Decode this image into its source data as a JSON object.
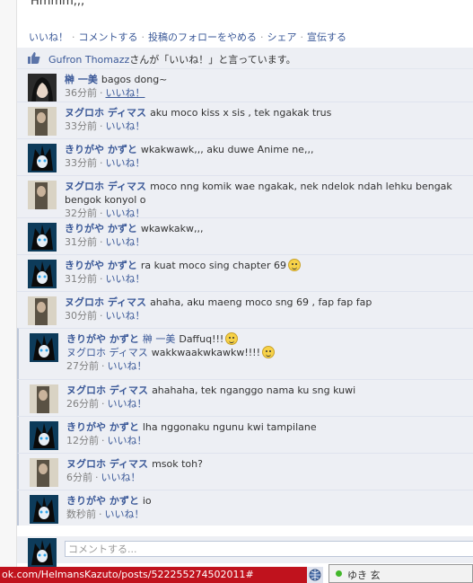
{
  "post": {
    "text": "Hmmm,,,"
  },
  "actions": [
    {
      "label": "いいね！"
    },
    {
      "label": "コメントする"
    },
    {
      "label": "投稿のフォローをやめる"
    },
    {
      "label": "シェア"
    },
    {
      "label": "宣伝する"
    }
  ],
  "likes": {
    "name": "Gufron Thomazz",
    "suffix": "さんが「いいね！」と言っています。"
  },
  "comments": [
    {
      "avatar": "black-hair",
      "author": "榊 一美",
      "text": "bagos dong~",
      "time": "36分前",
      "like": "いいね！"
    },
    {
      "avatar": "pale",
      "author": "ヌグロホ ディマス",
      "text": "aku moco kiss x sis , tek ngakak trus",
      "time": "33分前",
      "like": "いいね！"
    },
    {
      "avatar": "anime",
      "author": "きりがや かずと",
      "text": "wkakwawk,,, aku duwe Anime ne,,,",
      "time": "33分前",
      "like": "いいね！"
    },
    {
      "avatar": "pale",
      "author": "ヌグロホ ディマス",
      "text": "moco nng komik wae ngakak, nek ndelok ndah lehku bengak bengok konyol o",
      "time": "32分前",
      "like": "いいね！"
    },
    {
      "avatar": "anime",
      "author": "きりがや かずと",
      "text": "wkawkakw,,,",
      "time": "31分前",
      "like": "いいね！"
    },
    {
      "avatar": "anime",
      "author": "きりがや かずと",
      "text": "ra kuat moco sing chapter 69",
      "time": "31分前",
      "like": "いいね！"
    },
    {
      "avatar": "pale",
      "author": "ヌグロホ ディマス",
      "text": "ahaha, aku maeng moco sng 69 , fap fap fap",
      "time": "30分前",
      "like": "いいね！"
    },
    {
      "avatar": "anime",
      "author": "きりがや かずと",
      "mention": "榊 一美",
      "text": "Daffuq!!!",
      "mention2": "ヌグロホ ディマス",
      "text2": "wakkwaakwkawkw!!!!",
      "time": "27分前",
      "like": "いいね！"
    },
    {
      "avatar": "pale",
      "author": "ヌグロホ ディマス",
      "text": "ahahaha, tek nganggo nama ku sng kuwi",
      "time": "26分前",
      "like": "いいね！"
    },
    {
      "avatar": "anime",
      "author": "きりがや かずと",
      "text": "lha nggonaku ngunu kwi tampilane",
      "time": "12分前",
      "like": "いいね！"
    },
    {
      "avatar": "pale",
      "author": "ヌグロホ ディマス",
      "text": "msok toh?",
      "time": "6分前",
      "like": "いいね！"
    },
    {
      "avatar": "anime",
      "author": "きりがや かずと",
      "text": "io",
      "time": "数秒前",
      "like": "いいね！"
    }
  ],
  "composer": {
    "placeholder": "コメントする..."
  },
  "statusbar": {
    "url": "ok.com/HelmansKazuto/posts/522255274502011#"
  },
  "chat": {
    "name": "ゆき 玄"
  }
}
